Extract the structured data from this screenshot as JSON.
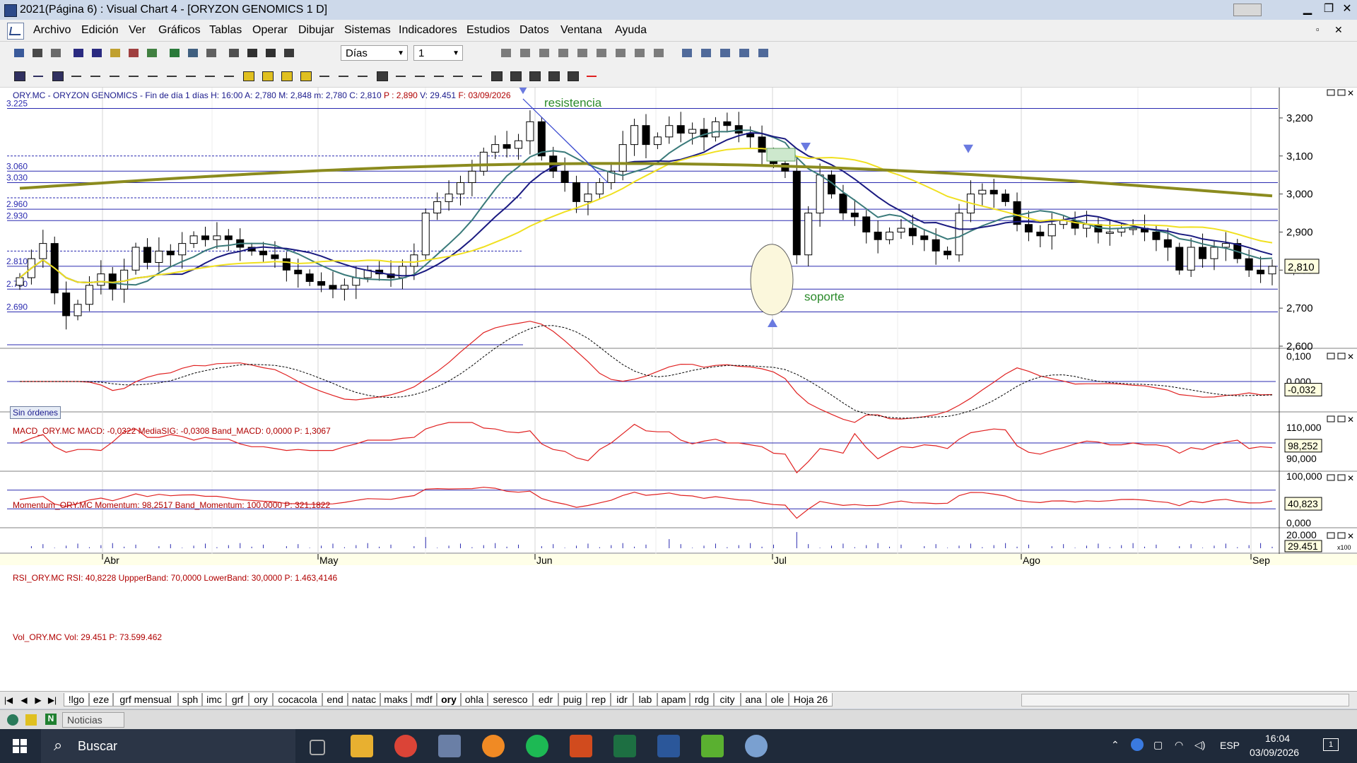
{
  "window": {
    "title": "2021(Página 6) : Visual Chart 4 - [ORYZON GENOMICS 1 D]"
  },
  "menu": [
    "Archivo",
    "Edición",
    "Ver",
    "Gráficos",
    "Tablas",
    "Operar",
    "Dibujar",
    "Sistemas",
    "Indicadores",
    "Estudios",
    "Datos",
    "Ventana",
    "Ayuda"
  ],
  "toolbar": {
    "period_value": "Días",
    "interval_value": "1"
  },
  "chart": {
    "header": {
      "symbol": "ORY.MC - ORYZON GENOMICS - Fin de día 1 días",
      "h": "H: 16:00",
      "a": "A: 2,780",
      "m": "M: 2,848",
      "mn": "m: 2,780",
      "c": "C: 2,810",
      "p": "P : 2,890",
      "v": "V: 29.451",
      "f": "F: 03/09/2026"
    },
    "annotations": {
      "resistance": "resistencia",
      "support": "soporte",
      "orders": "Sin órdenes"
    },
    "level_labels": [
      "3.225",
      "3.060",
      "3.030",
      "2.960",
      "2.930",
      "2.810",
      "2.750",
      "2.690"
    ],
    "price_ticks": [
      "3,200",
      "3,100",
      "3,000",
      "2,900",
      "2,800",
      "2,700",
      "2,600"
    ],
    "last_price": "2,810",
    "months": [
      "Abr",
      "May",
      "Jun",
      "Jul",
      "Ago",
      "Sep"
    ]
  },
  "macd": {
    "header": "MACD_ORY.MC  MACD: -0,0322  MediaSIG: -0,0308  Band_MACD: 0,0000  P: 1,3067",
    "ticks": [
      "0,100",
      "0,000"
    ],
    "last": "-0,032"
  },
  "momentum": {
    "header": "Momentum_ORY.MC  Momentum: 98,2517  Band_Momentum: 100,0000  P: 321,1822",
    "ticks": [
      "110,000",
      "90,000"
    ],
    "last": "98,252"
  },
  "rsi": {
    "header": "RSI_ORY.MC  RSI: 40,8228  UppperBand: 70,0000  LowerBand: 30,0000  P: 1.463,4146",
    "ticks": [
      "100,000",
      "0,000"
    ],
    "last": "40,823"
  },
  "volume": {
    "header": "Vol_ORY.MC  Vol: 29.451  P: 73.599.462",
    "ticks": [
      "20.000"
    ],
    "last": "29.451",
    "scale": "x100"
  },
  "tabs": [
    "!lgo",
    "eze",
    "grf mensual",
    "sph",
    "imc",
    "grf",
    "ory",
    "cocacola",
    "end",
    "natac",
    "maks",
    "mdf",
    "ory",
    "ohla",
    "seresco",
    "edr",
    "puig",
    "rep",
    "idr",
    "lab",
    "apam",
    "rdg",
    "city",
    "ana",
    "ole",
    "Hoja 26"
  ],
  "active_tab": 12,
  "news": {
    "label": "Noticias"
  },
  "taskbar": {
    "search": "Buscar",
    "lang": "ESP",
    "time": "16:04",
    "date": "03/09/2026",
    "notif": "1"
  },
  "colors": {
    "sma_long": "#8b8b1e",
    "sma_yellow": "#f0e020",
    "ema_navy": "#1a1a80",
    "ema_teal": "#3a7a7a",
    "line_red": "#e02020",
    "grid_blue": "#2a2ab0"
  }
}
